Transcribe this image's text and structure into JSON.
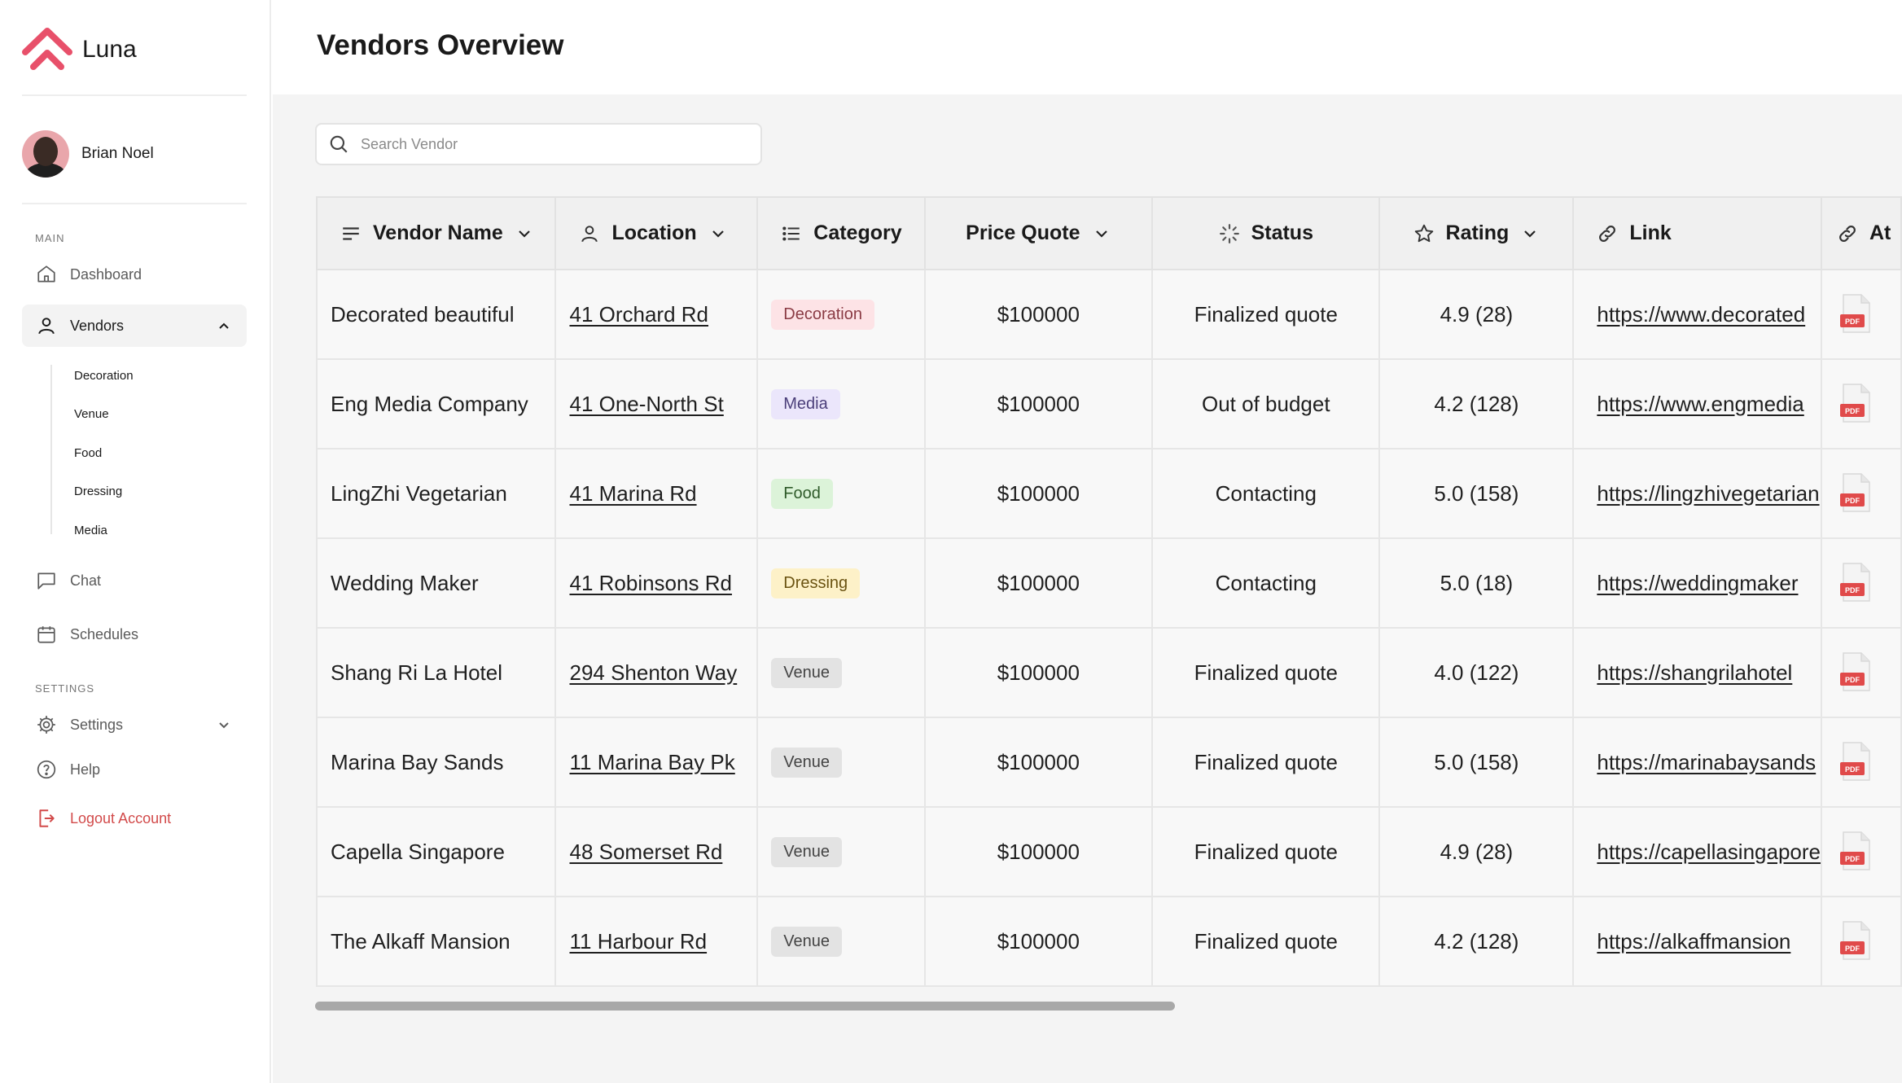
{
  "app": {
    "name": "Luna"
  },
  "user": {
    "name": "Brian Noel"
  },
  "sidebar": {
    "main_label": "MAIN",
    "settings_label": "SETTINGS",
    "items": {
      "dashboard": "Dashboard",
      "vendors": "Vendors",
      "chat": "Chat",
      "schedules": "Schedules",
      "settings": "Settings",
      "help": "Help",
      "logout": "Logout Account"
    },
    "vendor_subitems": [
      "Decoration",
      "Venue",
      "Food",
      "Dressing",
      "Media"
    ]
  },
  "page": {
    "title": "Vendors Overview"
  },
  "search": {
    "placeholder": "Search Vendor"
  },
  "table": {
    "columns": [
      "Vendor Name",
      "Location",
      "Category",
      "Price Quote",
      "Status",
      "Rating",
      "Link",
      "At"
    ],
    "rows": [
      {
        "vendor": "Decorated beautiful",
        "location": "41 Orchard Rd",
        "category": "Decoration",
        "price": "$100000",
        "status": "Finalized quote",
        "rating": "4.9 (28)",
        "link": "https://www.decorated"
      },
      {
        "vendor": "Eng Media Company",
        "location": "41 One-North St",
        "category": "Media",
        "price": "$100000",
        "status": "Out of budget",
        "rating": "4.2 (128)",
        "link": "https://www.engmedia"
      },
      {
        "vendor": "LingZhi Vegetarian",
        "location": "41 Marina Rd",
        "category": "Food",
        "price": "$100000",
        "status": "Contacting",
        "rating": "5.0 (158)",
        "link": "https://lingzhivegetarian"
      },
      {
        "vendor": "Wedding Maker",
        "location": "41 Robinsons Rd",
        "category": "Dressing",
        "price": "$100000",
        "status": "Contacting",
        "rating": "5.0 (18)",
        "link": "https://weddingmaker"
      },
      {
        "vendor": "Shang Ri La Hotel",
        "location": "294 Shenton Way",
        "category": "Venue",
        "price": "$100000",
        "status": "Finalized quote",
        "rating": "4.0 (122)",
        "link": "https://shangrilahotel"
      },
      {
        "vendor": "Marina Bay Sands",
        "location": "11 Marina Bay Pk",
        "category": "Venue",
        "price": "$100000",
        "status": "Finalized quote",
        "rating": "5.0 (158)",
        "link": "https://marinabaysands"
      },
      {
        "vendor": "Capella Singapore",
        "location": "48 Somerset Rd",
        "category": "Venue",
        "price": "$100000",
        "status": "Finalized quote",
        "rating": "4.9 (28)",
        "link": "https://capellasingapore"
      },
      {
        "vendor": "The Alkaff Mansion",
        "location": "11 Harbour Rd",
        "category": "Venue",
        "price": "$100000",
        "status": "Finalized quote",
        "rating": "4.2 (128)",
        "link": "https://alkaffmansion"
      }
    ],
    "attachment_label": "PDF"
  },
  "colors": {
    "brand": "#e8506a",
    "logout": "#d24a4a",
    "tags": {
      "Decoration": {
        "bg": "#fde3e6",
        "fg": "#8a3b44"
      },
      "Media": {
        "bg": "#ebe6fb",
        "fg": "#4b3f7a"
      },
      "Food": {
        "bg": "#dcf3d9",
        "fg": "#2f5b2a"
      },
      "Dressing": {
        "bg": "#fdf1c8",
        "fg": "#6b5312"
      },
      "Venue": {
        "bg": "#e3e3e3",
        "fg": "#444444"
      }
    }
  }
}
